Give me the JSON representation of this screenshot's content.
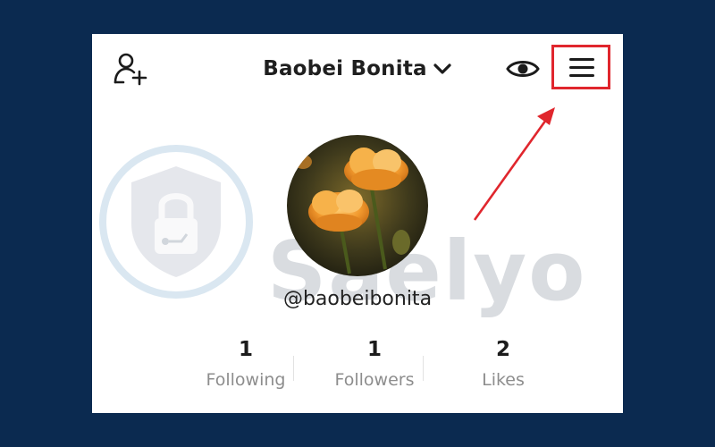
{
  "header": {
    "display_name": "Baobei Bonita",
    "icons": {
      "add_user": "add-user-icon",
      "dropdown": "chevron-down-icon",
      "eye": "eye-icon",
      "menu": "hamburger-menu-icon"
    },
    "highlight_color": "#e0262d"
  },
  "profile": {
    "username": "@baobeibonita",
    "avatar": "orange-flowers-photo"
  },
  "stats": [
    {
      "value": "1",
      "label": "Following"
    },
    {
      "value": "1",
      "label": "Followers"
    },
    {
      "value": "2",
      "label": "Likes"
    }
  ],
  "watermark": {
    "text": "Saelyo",
    "icon": "shield-lock-icon"
  },
  "annotation": {
    "arrow_color": "#e0262d",
    "points_to": "hamburger-menu-icon"
  },
  "colors": {
    "background": "#0b2a50",
    "card": "#ffffff"
  }
}
